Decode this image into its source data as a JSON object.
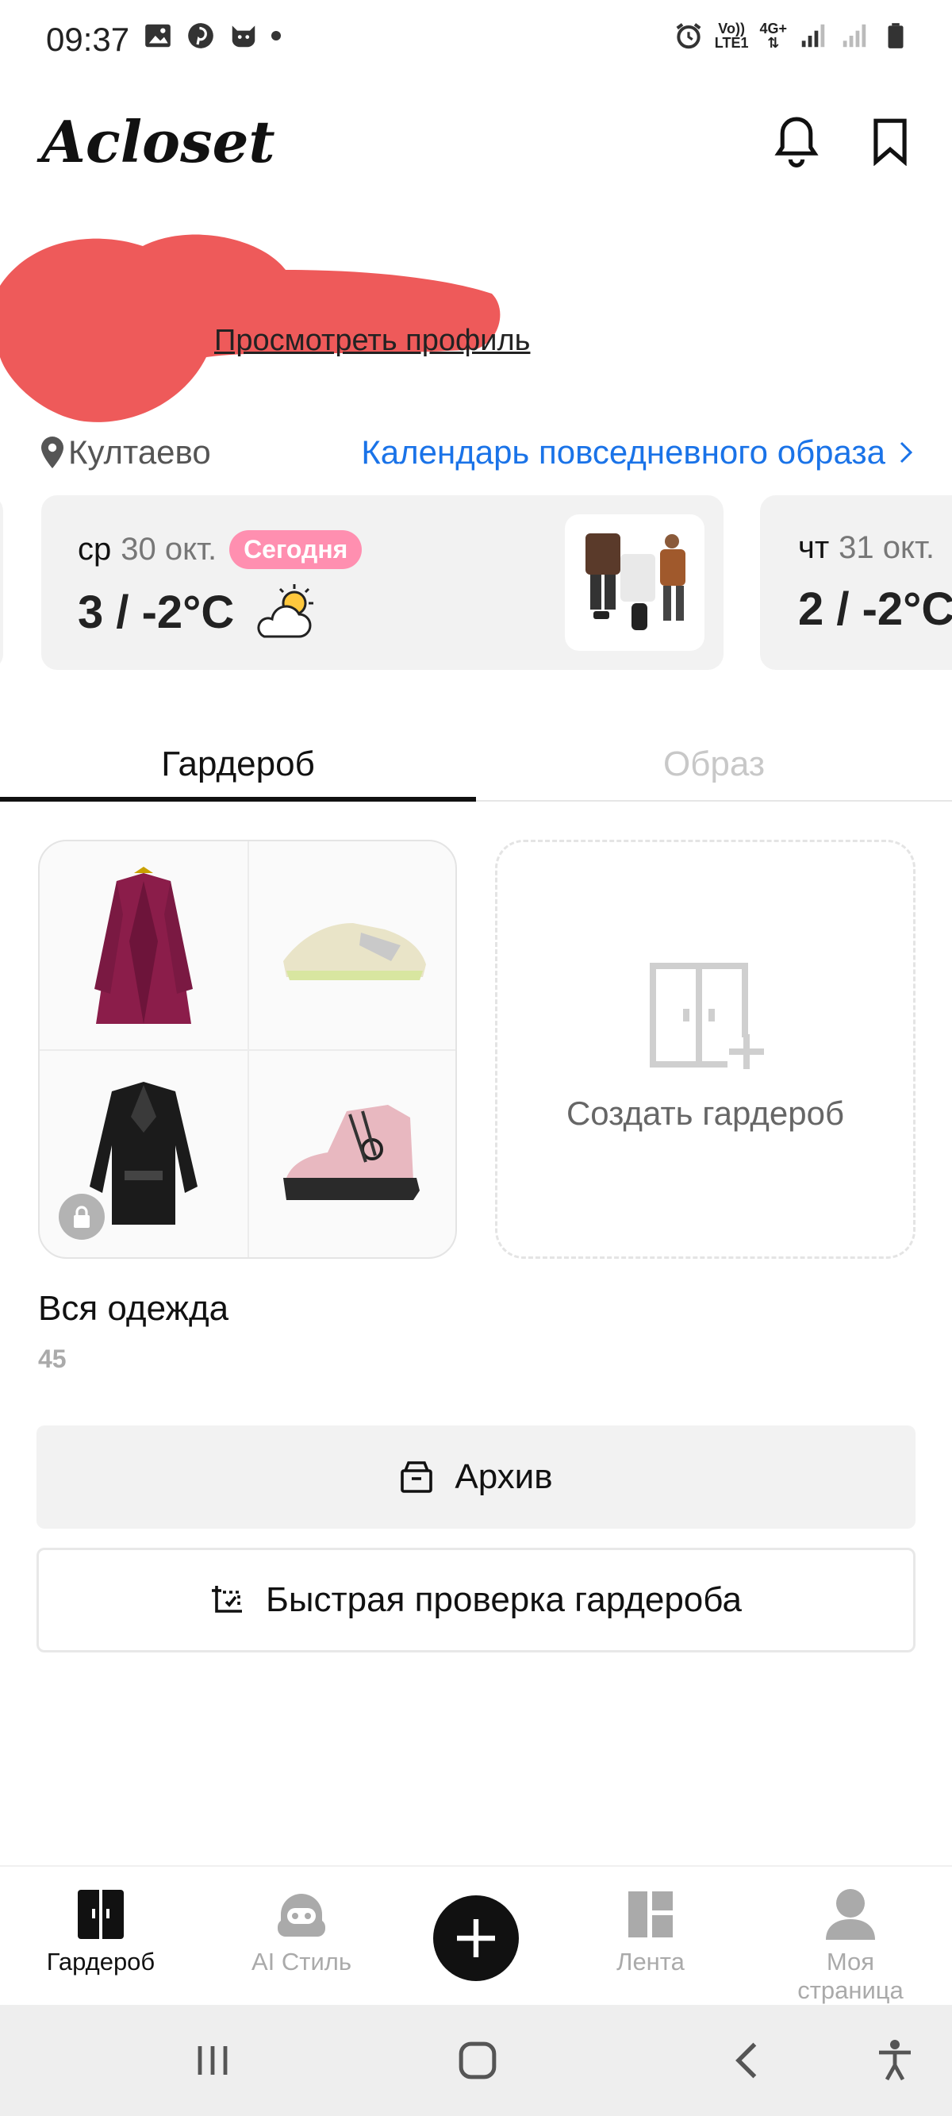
{
  "status_bar": {
    "time": "09:37",
    "left_icons": [
      "gallery-icon",
      "pinterest-icon",
      "cat-icon"
    ],
    "network_top": "Vo))",
    "network_bottom": "LTE1",
    "network2_top": "4G+",
    "right_icons": [
      "alarm-icon",
      "signal-icon",
      "signal-empty-icon",
      "battery-icon"
    ]
  },
  "header": {
    "logo": "Acloset",
    "icons": [
      "bell-icon",
      "bookmark-icon"
    ]
  },
  "profile": {
    "link_text": "Просмотреть профиль",
    "name_redaction_color": "#ee5555"
  },
  "location": {
    "city": "Култаево",
    "calendar_link": "Календарь повседневного образа",
    "calendar_color": "#1a73e8"
  },
  "weather": {
    "today": {
      "dow": "ср",
      "date": "30 окт.",
      "badge": "Сегодня",
      "temp": "3 / -2°C",
      "icon": "partly-sunny-icon"
    },
    "next": {
      "dow": "чт",
      "date": "31 окт.",
      "temp": "2 / -2°C"
    },
    "badge_color": "#ff8fb0"
  },
  "tabs": [
    {
      "label": "Гардероб",
      "active": true
    },
    {
      "label": "Образ",
      "active": false
    }
  ],
  "wardrobe": {
    "items": [
      "coat",
      "sneakers",
      "leather-jacket",
      "high-top-sneaker"
    ],
    "create_label": "Создать гардероб",
    "all_label": "Вся одежда",
    "all_count": "45"
  },
  "buttons": {
    "archive": "Архив",
    "quick_check": "Быстрая проверка гардероба"
  },
  "bottom_nav": [
    {
      "label": "Гардероб",
      "icon": "wardrobe-icon",
      "active": true
    },
    {
      "label": "AI Стиль",
      "icon": "robot-icon",
      "active": false
    },
    {
      "label": "",
      "icon": "plus-icon",
      "active": false
    },
    {
      "label": "Лента",
      "icon": "feed-icon",
      "active": false
    },
    {
      "label": "Моя страница",
      "icon": "person-icon",
      "active": false
    }
  ],
  "system_nav": [
    "recents-icon",
    "home-icon",
    "back-icon",
    "accessibility-icon"
  ]
}
